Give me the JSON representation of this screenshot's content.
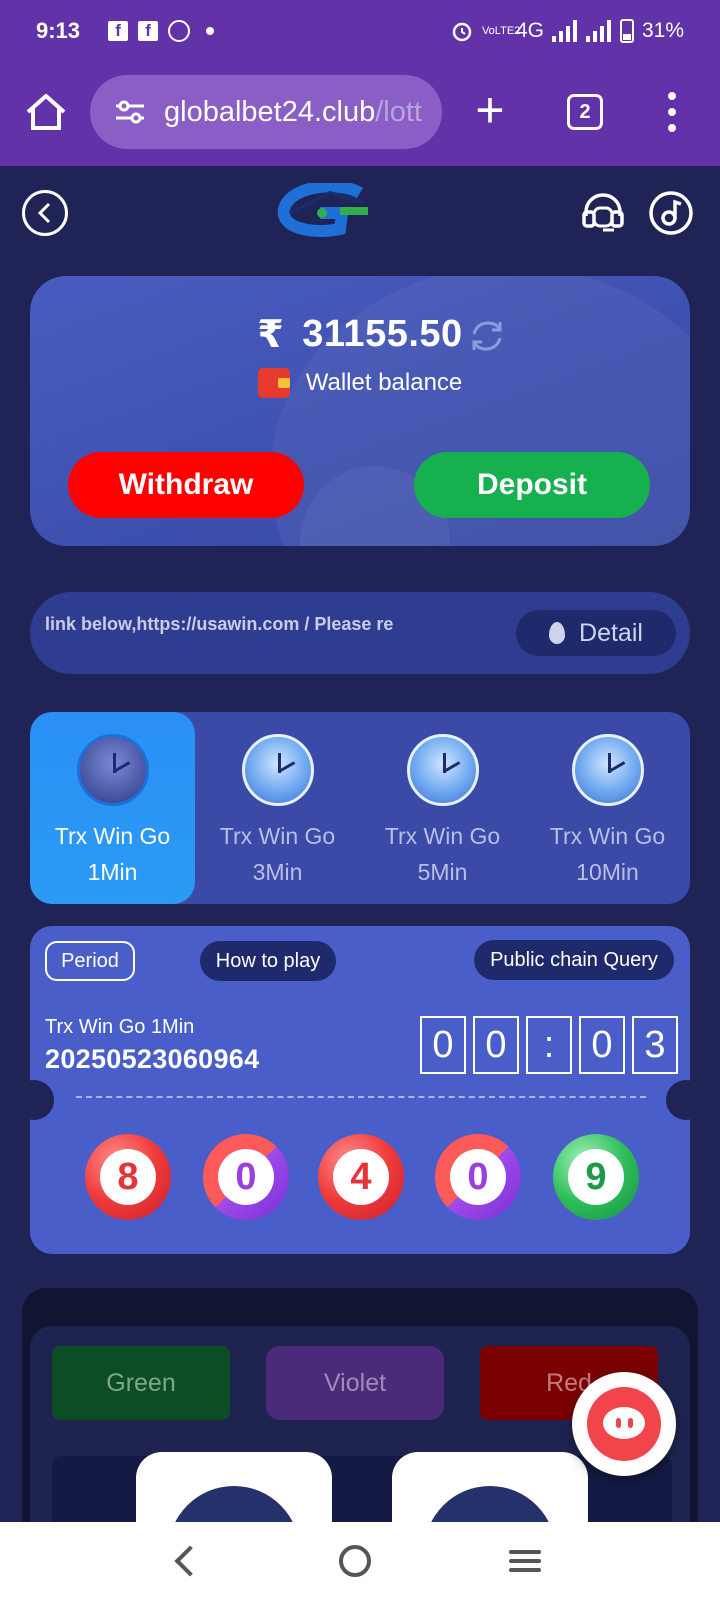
{
  "status_bar": {
    "time": "9:13",
    "network": "4G",
    "volte": "VoLTE2",
    "battery": "31%"
  },
  "browser": {
    "url_main": "globalbet24.club",
    "url_rest": "/lott",
    "tab_count": "2"
  },
  "wallet": {
    "currency_symbol": "₹",
    "balance": "31155.50",
    "label": "Wallet balance",
    "withdraw_label": "Withdraw",
    "deposit_label": "Deposit"
  },
  "notice": {
    "text": "link below,https://usawin.com / Please re",
    "detail_label": "Detail"
  },
  "modes": [
    {
      "line1": "Trx Win Go",
      "line2": "1Min",
      "active": true
    },
    {
      "line1": "Trx Win Go",
      "line2": "3Min",
      "active": false
    },
    {
      "line1": "Trx Win Go",
      "line2": "5Min",
      "active": false
    },
    {
      "line1": "Trx Win Go",
      "line2": "10Min",
      "active": false
    }
  ],
  "period": {
    "period_label": "Period",
    "how_to_play_label": "How to play",
    "chain_query_label": "Public chain Query",
    "game_name": "Trx Win Go 1Min",
    "period_number": "20250523060964",
    "timer": [
      "0",
      "0",
      ":",
      "0",
      "3"
    ],
    "result_balls": [
      {
        "number": "8",
        "color": "red"
      },
      {
        "number": "0",
        "color": "violet"
      },
      {
        "number": "4",
        "color": "red"
      },
      {
        "number": "0",
        "color": "violet"
      },
      {
        "number": "9",
        "color": "green"
      }
    ]
  },
  "bet_colors": {
    "green_label": "Green",
    "violet_label": "Violet",
    "red_label": "Red"
  },
  "colors": {
    "brand_purple": "#6233a8",
    "page_bg": "#1f2356",
    "withdraw": "#ff0000",
    "deposit": "#16b04f",
    "active_tab": "#2a8ff5"
  }
}
